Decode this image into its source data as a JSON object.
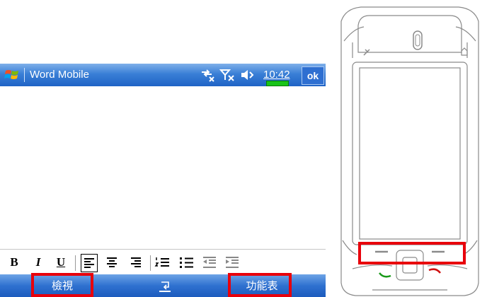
{
  "window": {
    "app_title": "Word Mobile",
    "time": "10:42",
    "ok_label": "ok"
  },
  "status_icons": [
    "connectivity-icon",
    "signal-off-icon",
    "volume-icon"
  ],
  "format_toolbar": [
    "B",
    "I",
    "U"
  ],
  "softkeys": {
    "left": "檢視",
    "right": "功能表"
  },
  "colors": {
    "title_blue": "#1f63c6",
    "highlight_red": "#e8000b",
    "battery_green": "#18c318"
  }
}
